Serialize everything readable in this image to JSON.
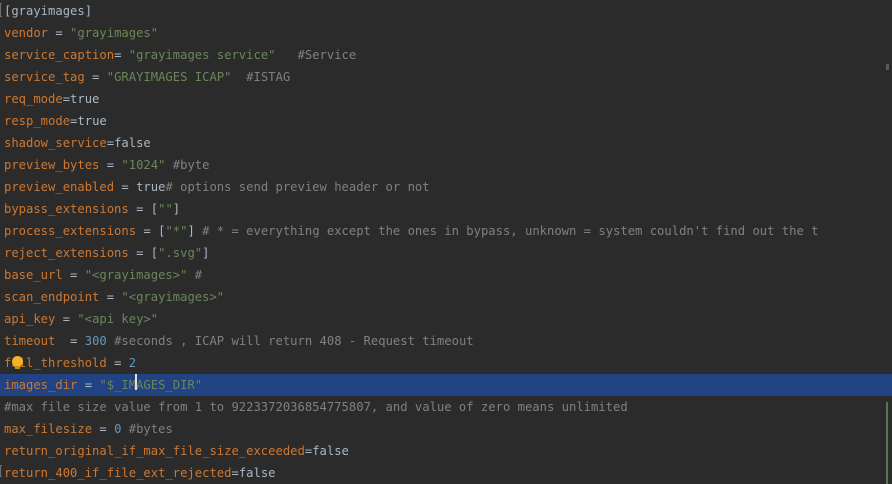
{
  "editor": {
    "lines": [
      {
        "tokens": [
          {
            "t": "section",
            "v": "[grayimages]"
          }
        ]
      },
      {
        "tokens": [
          {
            "t": "key",
            "v": "vendor"
          },
          {
            "t": "op",
            "v": " = "
          },
          {
            "t": "str",
            "v": "\"grayimages\""
          }
        ]
      },
      {
        "tokens": [
          {
            "t": "key",
            "v": "service_caption"
          },
          {
            "t": "op",
            "v": "= "
          },
          {
            "t": "str",
            "v": "\"grayimages service\""
          },
          {
            "t": "comment",
            "v": "   #Service"
          }
        ]
      },
      {
        "tokens": [
          {
            "t": "key",
            "v": "service_tag"
          },
          {
            "t": "op",
            "v": " = "
          },
          {
            "t": "str",
            "v": "\"GRAYIMAGES ICAP\""
          },
          {
            "t": "comment",
            "v": "  #ISTAG"
          }
        ]
      },
      {
        "tokens": [
          {
            "t": "key",
            "v": "req_mode"
          },
          {
            "t": "op",
            "v": "="
          },
          {
            "t": "bool",
            "v": "true"
          }
        ]
      },
      {
        "tokens": [
          {
            "t": "key",
            "v": "resp_mode"
          },
          {
            "t": "op",
            "v": "="
          },
          {
            "t": "bool",
            "v": "true"
          }
        ]
      },
      {
        "tokens": [
          {
            "t": "key",
            "v": "shadow_service"
          },
          {
            "t": "op",
            "v": "="
          },
          {
            "t": "bool",
            "v": "false"
          }
        ]
      },
      {
        "tokens": [
          {
            "t": "key",
            "v": "preview_bytes"
          },
          {
            "t": "op",
            "v": " = "
          },
          {
            "t": "str",
            "v": "\"1024\""
          },
          {
            "t": "comment",
            "v": " #byte"
          }
        ]
      },
      {
        "tokens": [
          {
            "t": "key",
            "v": "preview_enabled"
          },
          {
            "t": "op",
            "v": " = "
          },
          {
            "t": "bool",
            "v": "true"
          },
          {
            "t": "comment",
            "v": "# options send preview header or not"
          }
        ]
      },
      {
        "tokens": [
          {
            "t": "key",
            "v": "bypass_extensions"
          },
          {
            "t": "op",
            "v": " = "
          },
          {
            "t": "plain",
            "v": "["
          },
          {
            "t": "str",
            "v": "\"\""
          },
          {
            "t": "plain",
            "v": "]"
          }
        ]
      },
      {
        "tokens": [
          {
            "t": "key",
            "v": "process_extensions"
          },
          {
            "t": "op",
            "v": " = "
          },
          {
            "t": "plain",
            "v": "["
          },
          {
            "t": "str",
            "v": "\"*\""
          },
          {
            "t": "plain",
            "v": "]"
          },
          {
            "t": "comment",
            "v": " # * = everything except the ones in bypass, unknown = system couldn't find out the t"
          }
        ]
      },
      {
        "tokens": [
          {
            "t": "key",
            "v": "reject_extensions"
          },
          {
            "t": "op",
            "v": " = "
          },
          {
            "t": "plain",
            "v": "["
          },
          {
            "t": "str",
            "v": "\".svg\""
          },
          {
            "t": "plain",
            "v": "]"
          }
        ]
      },
      {
        "tokens": [
          {
            "t": "key",
            "v": "base_url"
          },
          {
            "t": "op",
            "v": " = "
          },
          {
            "t": "str",
            "v": "\"<grayimages>\""
          },
          {
            "t": "comment",
            "v": " #"
          }
        ]
      },
      {
        "tokens": [
          {
            "t": "key",
            "v": "scan_endpoint"
          },
          {
            "t": "op",
            "v": " = "
          },
          {
            "t": "str",
            "v": "\"<grayimages>\""
          }
        ]
      },
      {
        "tokens": [
          {
            "t": "key",
            "v": "api_key"
          },
          {
            "t": "op",
            "v": " = "
          },
          {
            "t": "str",
            "v": "\"<api key>\""
          }
        ]
      },
      {
        "tokens": [
          {
            "t": "key",
            "v": "timeout"
          },
          {
            "t": "op",
            "v": "  = "
          },
          {
            "t": "num",
            "v": "300"
          },
          {
            "t": "comment",
            "v": " #seconds , ICAP will return 408 - Request timeout"
          }
        ]
      },
      {
        "tokens": [
          {
            "t": "key",
            "v": "fail_threshold"
          },
          {
            "t": "op",
            "v": " = "
          },
          {
            "t": "num",
            "v": "2"
          }
        ]
      },
      {
        "selected": true,
        "tokens": [
          {
            "t": "key",
            "v": "images_dir"
          },
          {
            "t": "op",
            "v": " = "
          },
          {
            "t": "str",
            "v": "\"$_IMAGES_DIR\""
          }
        ]
      },
      {
        "tokens": [
          {
            "t": "comment",
            "v": "#max file size value from 1 to 9223372036854775807, and value of zero means unlimited"
          }
        ]
      },
      {
        "tokens": [
          {
            "t": "key",
            "v": "max_filesize"
          },
          {
            "t": "op",
            "v": " = "
          },
          {
            "t": "num",
            "v": "0"
          },
          {
            "t": "comment",
            "v": " #bytes"
          }
        ]
      },
      {
        "tokens": [
          {
            "t": "key",
            "v": "return_original_if_max_file_size_exceeded"
          },
          {
            "t": "op",
            "v": "="
          },
          {
            "t": "bool",
            "v": "false"
          }
        ]
      },
      {
        "tokens": [
          {
            "t": "key",
            "v": "return_400_if_file_ext_rejected"
          },
          {
            "t": "op",
            "v": "="
          },
          {
            "t": "bool",
            "v": "false"
          }
        ]
      }
    ]
  },
  "gutter": {
    "intention_icon": "lightbulb-icon",
    "fold_icon": "fold-bracket-icon"
  },
  "colors": {
    "background": "#2b2b2b",
    "key": "#cc7832",
    "string": "#6a8759",
    "number": "#6897bb",
    "comment": "#808080",
    "text": "#a9b7c6",
    "selection": "#214283",
    "change_marker": "#4e7f47"
  }
}
